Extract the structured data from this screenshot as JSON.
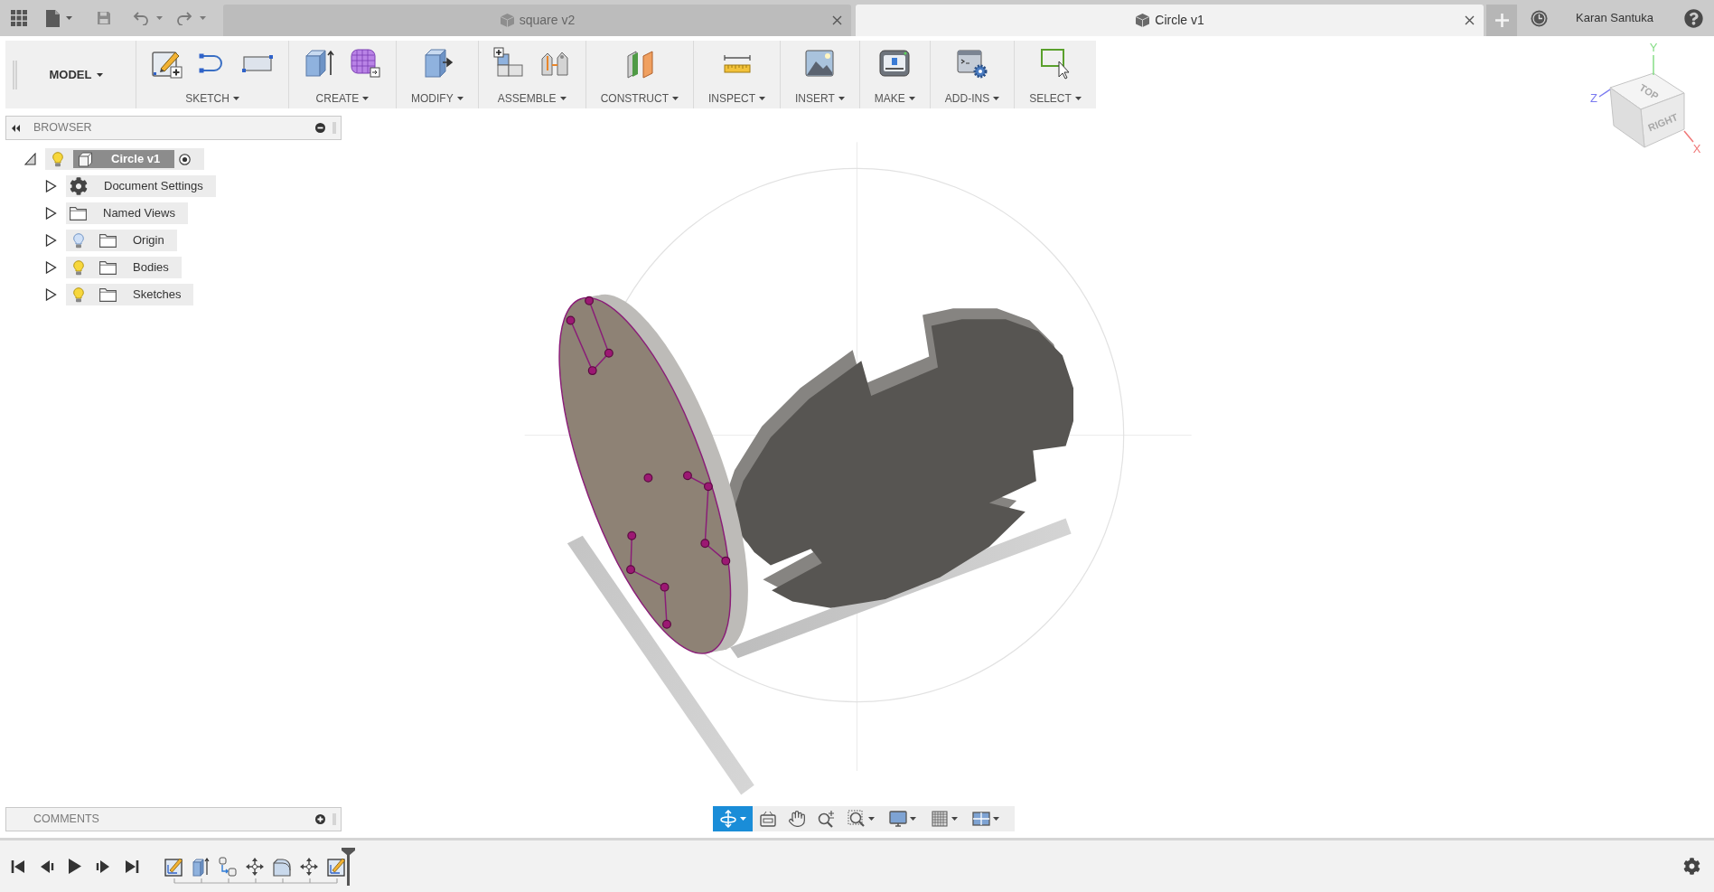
{
  "top_bar": {
    "tabs": [
      {
        "label": "square v2",
        "selected": false
      },
      {
        "label": "Circle v1",
        "selected": true
      }
    ],
    "user": "Karan Santuka"
  },
  "toolbar": {
    "workspace": "MODEL",
    "groups": [
      {
        "label": "SKETCH",
        "tools": [
          {
            "kind": "sketch"
          },
          {
            "kind": "line"
          },
          {
            "kind": "rectangle"
          }
        ]
      },
      {
        "label": "CREATE",
        "tools": [
          {
            "kind": "extrude"
          },
          {
            "kind": "form"
          }
        ]
      },
      {
        "label": "MODIFY",
        "tools": [
          {
            "kind": "press-pull"
          }
        ]
      },
      {
        "label": "ASSEMBLE",
        "tools": [
          {
            "kind": "new-component"
          },
          {
            "kind": "joint"
          }
        ]
      },
      {
        "label": "CONSTRUCT",
        "tools": [
          {
            "kind": "plane"
          }
        ]
      },
      {
        "label": "INSPECT",
        "tools": [
          {
            "kind": "measure"
          }
        ]
      },
      {
        "label": "INSERT",
        "tools": [
          {
            "kind": "image"
          }
        ]
      },
      {
        "label": "MAKE",
        "tools": [
          {
            "kind": "print"
          }
        ]
      },
      {
        "label": "ADD-INS",
        "tools": [
          {
            "kind": "scripts"
          }
        ]
      },
      {
        "label": "SELECT",
        "tools": [
          {
            "kind": "select"
          }
        ]
      }
    ]
  },
  "browser": {
    "title": "BROWSER",
    "root": {
      "label": "Circle v1",
      "expanded": true,
      "visible": true,
      "active": true,
      "children": [
        {
          "label": "Document Settings",
          "kind": "settings",
          "expanded": false
        },
        {
          "label": "Named Views",
          "kind": "views",
          "expanded": false
        },
        {
          "label": "Origin",
          "kind": "folder",
          "expanded": false,
          "visible": false
        },
        {
          "label": "Bodies",
          "kind": "folder",
          "expanded": false,
          "visible": true
        },
        {
          "label": "Sketches",
          "kind": "folder",
          "expanded": false,
          "visible": true
        }
      ]
    }
  },
  "view_cube": {
    "faces": {
      "top": "TOP",
      "right": "RIGHT"
    },
    "axes": [
      {
        "label": "Y",
        "color": "#86dd86"
      },
      {
        "label": "Z",
        "color": "#7a7af0"
      },
      {
        "label": "X",
        "color": "#f07878"
      }
    ]
  },
  "comments": {
    "title": "COMMENTS"
  },
  "nav_bar": [
    {
      "kind": "orbit",
      "selected": true
    },
    {
      "kind": "look-at",
      "selected": false
    },
    {
      "kind": "pan",
      "selected": false
    },
    {
      "kind": "zoom",
      "selected": false
    },
    {
      "kind": "fit",
      "selected": false
    },
    {
      "kind": "display",
      "selected": false
    },
    {
      "kind": "grid",
      "selected": false
    },
    {
      "kind": "viewports",
      "selected": false
    }
  ],
  "timeline": {
    "steps": [
      {
        "kind": "sketch"
      },
      {
        "kind": "extrude"
      },
      {
        "kind": "joint"
      },
      {
        "kind": "move"
      },
      {
        "kind": "fillet"
      },
      {
        "kind": "move"
      },
      {
        "kind": "sketch"
      }
    ]
  }
}
